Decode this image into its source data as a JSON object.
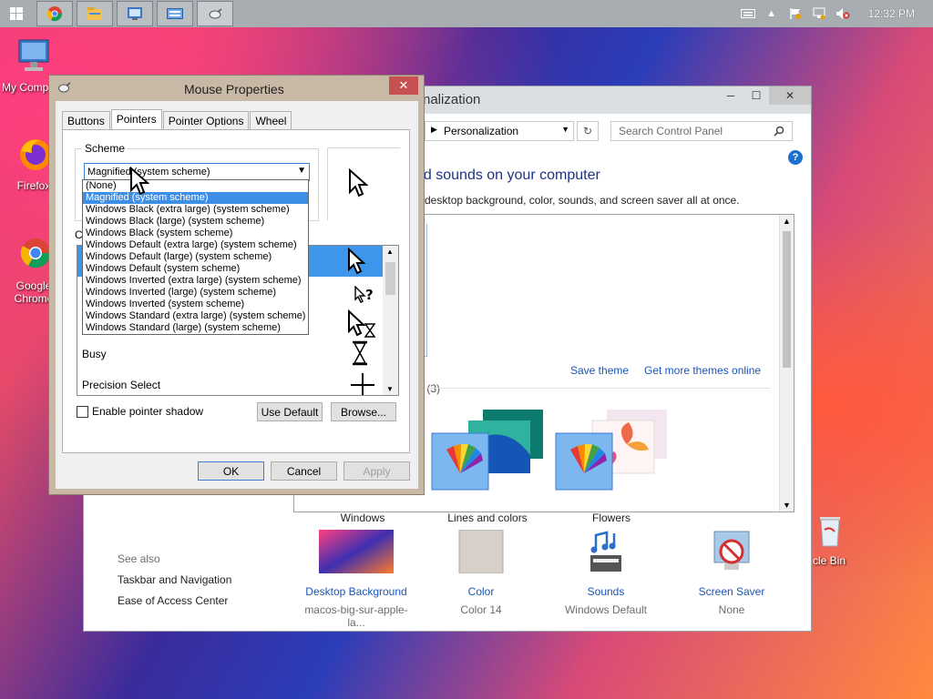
{
  "taskbar": {
    "clock": "12:32 PM",
    "apps": [
      "start-icon",
      "chrome-icon",
      "file-explorer-icon",
      "control-panel-icon",
      "keyboard-icon",
      "mouse-icon"
    ]
  },
  "desktop": {
    "icons": [
      {
        "label": "My Comp"
      },
      {
        "label": "Firefox"
      },
      {
        "label": "Google Chrome"
      },
      {
        "label": "cle Bin"
      }
    ]
  },
  "control_panel": {
    "title": "nalization",
    "address": "Personalization",
    "search_placeholder": "Search Control Panel",
    "heading": "nd sounds on your computer",
    "subtitle": "e desktop background, color, sounds, and screen saver all at once.",
    "save_theme": "Save theme",
    "get_more_themes": "Get more themes online",
    "installed_label": "s (3)",
    "themes": [
      {
        "name": "Windows"
      },
      {
        "name": "Lines and colors"
      },
      {
        "name": "Flowers"
      }
    ],
    "see_also": {
      "label": "See also",
      "items": [
        "Taskbar and Navigation",
        "Ease of Access Center"
      ]
    },
    "tiles": [
      {
        "title": "Desktop Background",
        "value": "macos-big-sur-apple-la..."
      },
      {
        "title": "Color",
        "value": "Color 14"
      },
      {
        "title": "Sounds",
        "value": "Windows Default"
      },
      {
        "title": "Screen Saver",
        "value": "None"
      }
    ],
    "help": "?"
  },
  "mouse_properties": {
    "title": "Mouse Properties",
    "tabs": [
      "Buttons",
      "Pointers",
      "Pointer Options",
      "Wheel"
    ],
    "selected_tab": "Pointers",
    "scheme_label": "Scheme",
    "scheme_value": "Magnified (system scheme)",
    "customize_label": "Cu",
    "cursor_rows": [
      "Busy",
      "Precision Select"
    ],
    "enable_shadow": "Enable pointer shadow",
    "use_default": "Use Default",
    "browse": "Browse...",
    "ok": "OK",
    "cancel": "Cancel",
    "apply": "Apply",
    "dropdown_options": [
      "(None)",
      "Magnified (system scheme)",
      "Windows Black (extra large) (system scheme)",
      "Windows Black (large) (system scheme)",
      "Windows Black (system scheme)",
      "Windows Default (extra large) (system scheme)",
      "Windows Default (large) (system scheme)",
      "Windows Default (system scheme)",
      "Windows Inverted (extra large) (system scheme)",
      "Windows Inverted (large) (system scheme)",
      "Windows Inverted (system scheme)",
      "Windows Standard (extra large) (system scheme)",
      "Windows Standard (large) (system scheme)"
    ],
    "highlighted_option_index": 1
  }
}
